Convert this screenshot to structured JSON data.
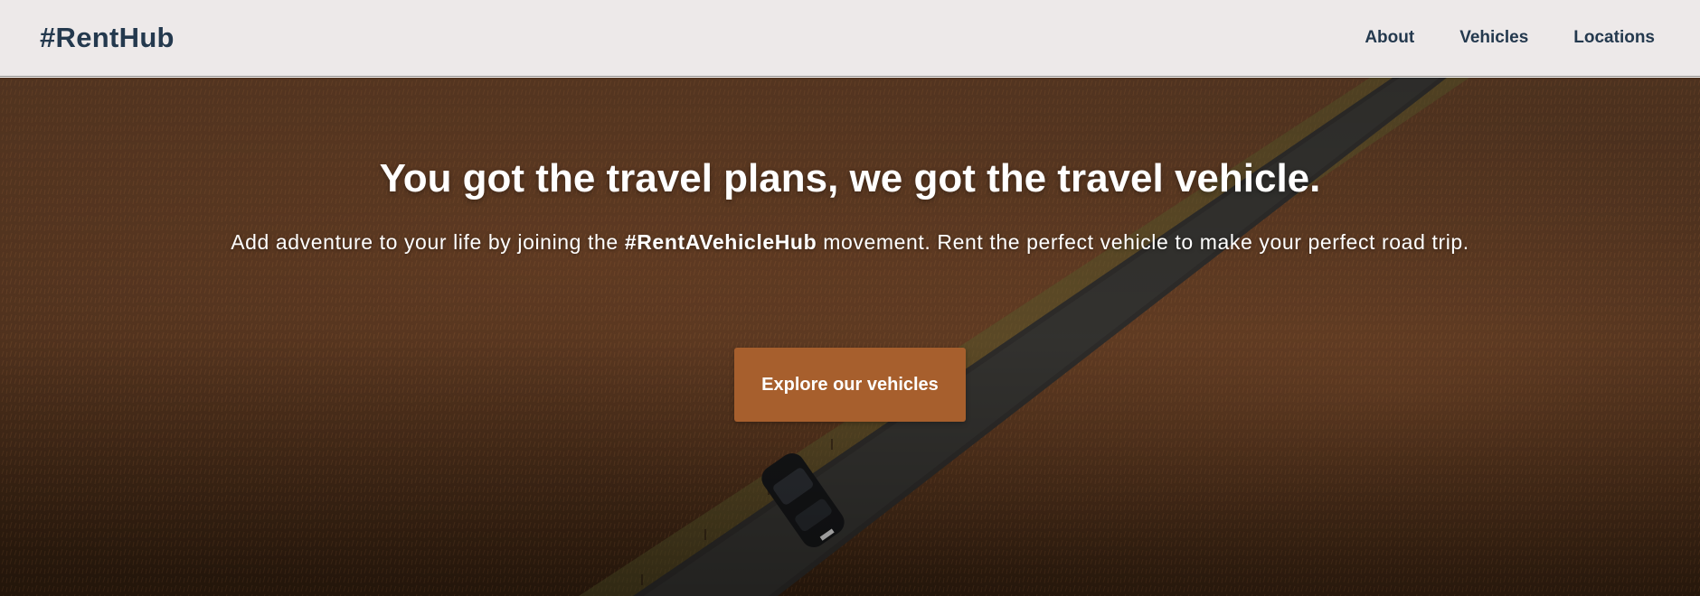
{
  "header": {
    "logo": "#RentHub",
    "nav": [
      {
        "label": "About"
      },
      {
        "label": "Vehicles"
      },
      {
        "label": "Locations"
      }
    ]
  },
  "hero": {
    "title": "You got the travel plans, we got the travel vehicle.",
    "subtitle_before": "Add adventure to your life by joining the ",
    "subtitle_highlight": "#RentAVehicleHub",
    "subtitle_after": " movement. Rent the perfect vehicle to make your perfect road trip.",
    "cta_label": "Explore our vehicles",
    "background_image": "aerial-road-through-moorland-with-car"
  },
  "colors": {
    "header_bg": "#ede9e9",
    "brand_text": "#24394e",
    "cta_bg": "#a75f2d",
    "hero_text": "#ffffff"
  }
}
